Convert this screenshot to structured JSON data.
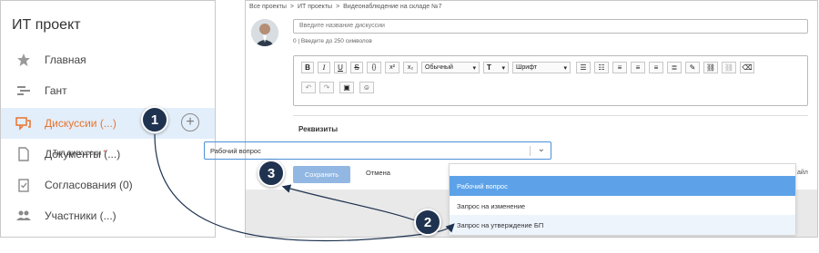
{
  "sidebar": {
    "title": "ИТ проект",
    "items": [
      {
        "label": "Главная",
        "icon": "star-icon"
      },
      {
        "label": "Гант",
        "icon": "gantt-icon"
      },
      {
        "label": "Дискуссии (...)",
        "icon": "discussion-icon",
        "active": true
      },
      {
        "label": "Документы (...)",
        "icon": "document-icon"
      },
      {
        "label": "Согласования (0)",
        "icon": "approval-icon"
      },
      {
        "label": "Участники (...)",
        "icon": "users-icon"
      }
    ]
  },
  "breadcrumb": [
    "Все проекты",
    "ИТ проекты",
    "Видеонаблюдение на складе №7"
  ],
  "form": {
    "name_placeholder": "Введите название дискуссии",
    "name_hint": "0 | Введите до 250 символов",
    "toolbar": {
      "style_select": "Обычный",
      "font_select": "Шрифт"
    },
    "section_title": "Реквизиты",
    "type_label": "Тип дискуссии",
    "required_mark": "*",
    "type_value": "Рабочий вопрос",
    "save_label": "Сохранить",
    "cancel_label": "Отмена",
    "file_link_partial": "айл"
  },
  "dropdown_options": [
    "Рабочий вопрос",
    "Запрос на изменение",
    "Запрос на утверждение БП"
  ],
  "callouts": [
    "1",
    "2",
    "3"
  ],
  "colors": {
    "active_text": "#e8742d",
    "active_bg": "#e3eefb",
    "callout": "#1f3350",
    "option_highlight": "#5da2e8",
    "save_button": "#92b7e3"
  }
}
